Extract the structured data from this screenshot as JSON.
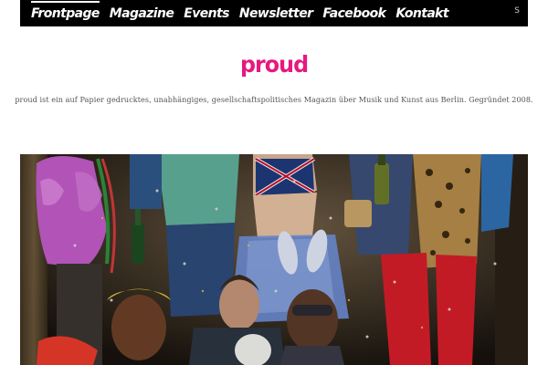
{
  "nav": {
    "items": [
      {
        "label": "Frontpage",
        "active": true
      },
      {
        "label": "Magazine",
        "active": false
      },
      {
        "label": "Events",
        "active": false
      },
      {
        "label": "Newsletter",
        "active": false
      },
      {
        "label": "Facebook",
        "active": false
      },
      {
        "label": "Kontakt",
        "active": false
      }
    ],
    "search_icon": "S"
  },
  "logo": {
    "text": "proud",
    "color": "#e6197f"
  },
  "tagline": "proud ist ein auf Papier gedrucktes, unabhängiges, gesellschaftspolitisches Magazin über Musik und Kunst aus Berlin. Gegründet 2008.",
  "hero": {
    "subject": "party-group-photo"
  }
}
